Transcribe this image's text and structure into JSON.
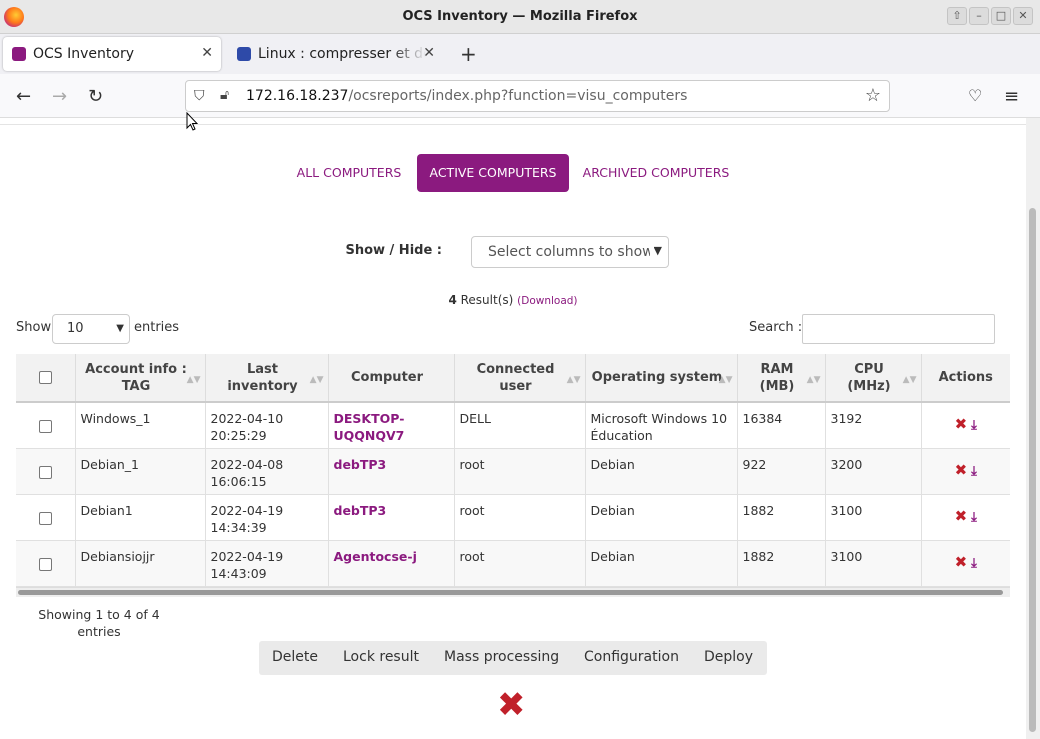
{
  "window": {
    "title": "OCS Inventory — Mozilla Firefox"
  },
  "browser": {
    "tabs": [
      {
        "label": "OCS Inventory",
        "favicon_color": "#8b1a7f"
      },
      {
        "label": "Linux : compresser et déc",
        "favicon_color": "#2e4aa8"
      }
    ],
    "url_host": "172.16.18.237",
    "url_path": "/ocsreports/index.php?function=visu_computers"
  },
  "page": {
    "filter_tabs": [
      "ALL COMPUTERS",
      "ACTIVE COMPUTERS",
      "ARCHIVED COMPUTERS"
    ],
    "active_filter": "ACTIVE COMPUTERS",
    "show_hide_label": "Show / Hide :",
    "columns_select_placeholder": "Select columns to show",
    "result_count": "4",
    "result_label": " Result(s) ",
    "download_link": "(Download)",
    "show_label": "Show",
    "entries_value": "10",
    "entries_label": "entries",
    "search_label": "Search :",
    "search_value": "",
    "table": {
      "headers": [
        "Account info : TAG",
        "Last inventory",
        "Computer",
        "Connected user",
        "Operating system",
        "RAM (MB)",
        "CPU (MHz)",
        "Actions"
      ],
      "rows": [
        {
          "tag": "Windows_1",
          "last_inventory": "2022-04-10 20:25:29",
          "computer": "DESKTOP-UQQNQV7",
          "user": "DELL",
          "os": "Microsoft Windows 10 Éducation",
          "ram": "16384",
          "cpu": "3192"
        },
        {
          "tag": "Debian_1",
          "last_inventory": "2022-04-08 16:06:15",
          "computer": "debTP3",
          "user": "root",
          "os": "Debian",
          "ram": "922",
          "cpu": "3200"
        },
        {
          "tag": "Debian1",
          "last_inventory": "2022-04-19 14:34:39",
          "computer": "debTP3",
          "user": "root",
          "os": "Debian",
          "ram": "1882",
          "cpu": "3100"
        },
        {
          "tag": "Debiansiojjr",
          "last_inventory": "2022-04-19 14:43:09",
          "computer": "Agentocse-j",
          "user": "root",
          "os": "Debian",
          "ram": "1882",
          "cpu": "3100"
        }
      ]
    },
    "showing_text": "Showing 1 to 4 of 4 entries",
    "action_buttons": [
      "Delete",
      "Lock result",
      "Mass processing",
      "Configuration",
      "Deploy"
    ]
  },
  "colors": {
    "accent": "#8b1a7f",
    "delete_red": "#c0202a"
  }
}
